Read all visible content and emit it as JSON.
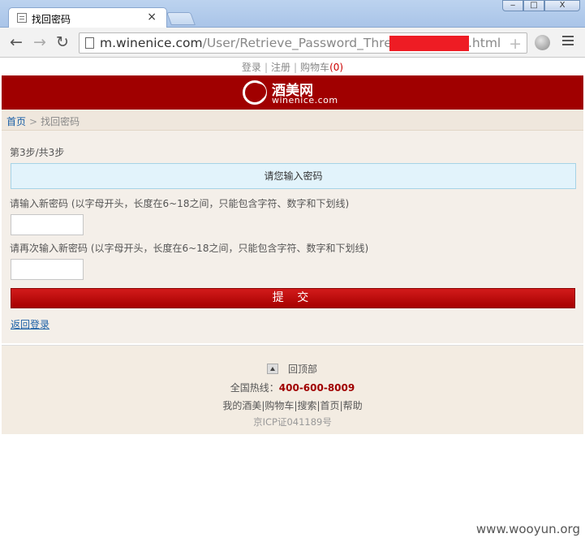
{
  "browser": {
    "tab_title": "找回密码",
    "tab_close": "×",
    "url_host": "m.winenice.com",
    "url_path": "/User/Retrieve_Password_Three-",
    "url_tail": ".html",
    "win_min": "‒",
    "win_max": "□",
    "win_close": "X",
    "back_glyph": "←",
    "forward_glyph": "→",
    "reload_glyph": "↻",
    "star_glyph": "+"
  },
  "topnav": {
    "login": "登录",
    "register": "注册",
    "cart": "购物车",
    "cart_count": "(0)"
  },
  "logo": {
    "cn": "酒美网",
    "en": "winenice.com"
  },
  "breadcrumb": {
    "home": "首页",
    "arrow": ">",
    "current": "找回密码"
  },
  "form": {
    "step": "第3步/共3步",
    "notice": "请您输入密码",
    "label_new": "请输入新密码 (以字母开头，长度在6~18之间，只能包含字符、数字和下划线)",
    "label_confirm": "请再次输入新密码 (以字母开头，长度在6~18之间，只能包含字符、数字和下划线)",
    "new_value": "",
    "confirm_value": "",
    "submit": "提 交",
    "back_login": "返回登录"
  },
  "footer": {
    "to_top": "回顶部",
    "hotline_label": "全国热线：",
    "hotline_number": "400-600-8009",
    "links": [
      "我的酒美",
      "购物车",
      "搜索",
      "首页",
      "帮助"
    ],
    "icp": "京ICP证041189号"
  },
  "watermark": "www.wooyun.org",
  "colors": {
    "brand_red": "#a00000",
    "page_bg": "#f4efe9",
    "notice_bg": "#e2f3fb",
    "redaction": "#ee1c24"
  }
}
